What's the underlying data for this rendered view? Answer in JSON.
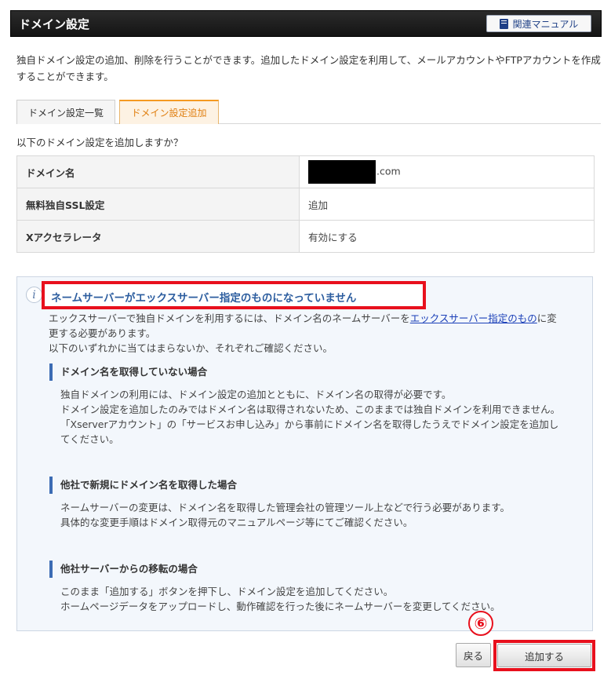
{
  "header": {
    "title": "ドメイン設定",
    "manual_label": "関連マニュアル",
    "manual_icon": "book-icon"
  },
  "description": "独自ドメイン設定の追加、削除を行うことができます。追加したドメイン設定を利用して、メールアカウントやFTPアカウントを作成することができます。",
  "tabs": [
    {
      "label": "ドメイン設定一覧",
      "active": false
    },
    {
      "label": "ドメイン設定追加",
      "active": true
    }
  ],
  "confirm": {
    "question": "以下のドメイン設定を追加しますか？",
    "rows": [
      {
        "label": "ドメイン名",
        "value": ".com"
      },
      {
        "label": "無料独自SSL設定",
        "value": "追加"
      },
      {
        "label": "Xアクセラレータ",
        "value": "有効にする"
      }
    ]
  },
  "notice": {
    "icon": "info-icon",
    "title": "ネームサーバーがエックスサーバー指定のものになっていません",
    "body_pre": "エックスサーバーで独自ドメインを利用するには、ドメイン名のネームサーバーを",
    "body_link": "エックスサーバー指定のもの",
    "body_post": "に変更する必要があります。",
    "body_line2": "以下のいずれかに当てはまらないか、それぞれご確認ください。",
    "sections": [
      {
        "heading": "ドメイン名を取得していない場合",
        "lines": [
          "独自ドメインの利用には、ドメイン設定の追加とともに、ドメイン名の取得が必要です。",
          "ドメイン設定を追加したのみではドメイン名は取得されないため、このままでは独自ドメインを利用できません。",
          "「Xserverアカウント」の「サービスお申し込み」から事前にドメイン名を取得したうえでドメイン設定を追加してください。"
        ]
      },
      {
        "heading": "他社で新規にドメイン名を取得した場合",
        "lines": [
          "ネームサーバーの変更は、ドメイン名を取得した管理会社の管理ツール上などで行う必要があります。",
          "具体的な変更手順はドメイン取得元のマニュアルページ等にてご確認ください。"
        ]
      },
      {
        "heading": "他社サーバーからの移転の場合",
        "lines": [
          "このまま「追加する」ボタンを押下し、ドメイン設定を追加してください。",
          "ホームページデータをアップロードし、動作確認を行った後にネームサーバーを変更してください。"
        ]
      }
    ]
  },
  "step_marker": "⑥",
  "buttons": {
    "back": "戻る",
    "add": "追加する"
  },
  "colors": {
    "highlight": "#e8101d",
    "active_tab": "#f59a22",
    "link": "#1a3fb8",
    "notice_title": "#2c5d9f"
  }
}
